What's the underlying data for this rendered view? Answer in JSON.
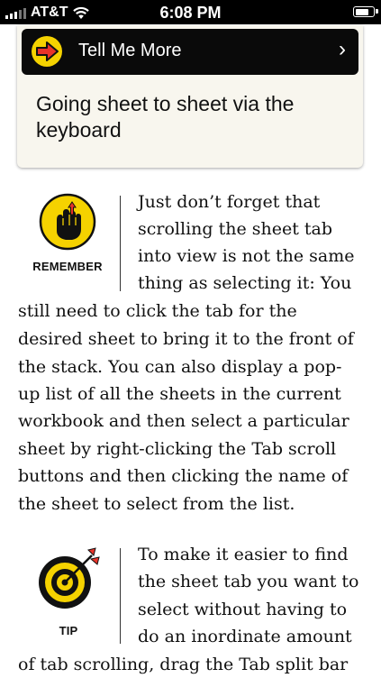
{
  "status_bar": {
    "carrier": "AT&T",
    "time": "6:08 PM",
    "signal_bars_of_5": 3,
    "battery_level": 0.8
  },
  "card": {
    "header_title": "Tell Me More",
    "chevron": "›",
    "icon": "arrow-right-icon",
    "body": "Going sheet to sheet via the keyboard"
  },
  "remember": {
    "label": "REMEMBER",
    "icon": "raised-fist-icon",
    "lines": [
      "Just don’t forget that",
      "scrolling the sheet tab",
      "into view is not the same",
      "thing as selecting it: You",
      "still need to click the tab for the",
      "desired sheet to bring it to the front of",
      "the stack. You can also display a pop-",
      "up list of all the sheets in the current",
      "workbook and then select a particular",
      "sheet by right-clicking the Tab scroll",
      "buttons and then clicking the name of",
      "the sheet to select from the list."
    ]
  },
  "tip": {
    "label": "TIP",
    "icon": "target-dart-icon",
    "lines": [
      "To make it easier to find",
      "the sheet tab you want to",
      "select without having to",
      "do an inordinate amount",
      "of tab scrolling, drag the Tab split bar"
    ]
  },
  "colors": {
    "accent_yellow": "#f5d200",
    "arrow_red": "#e8332a",
    "card_bg": "#f8f6ee",
    "header_bg": "#0a0a0a"
  }
}
